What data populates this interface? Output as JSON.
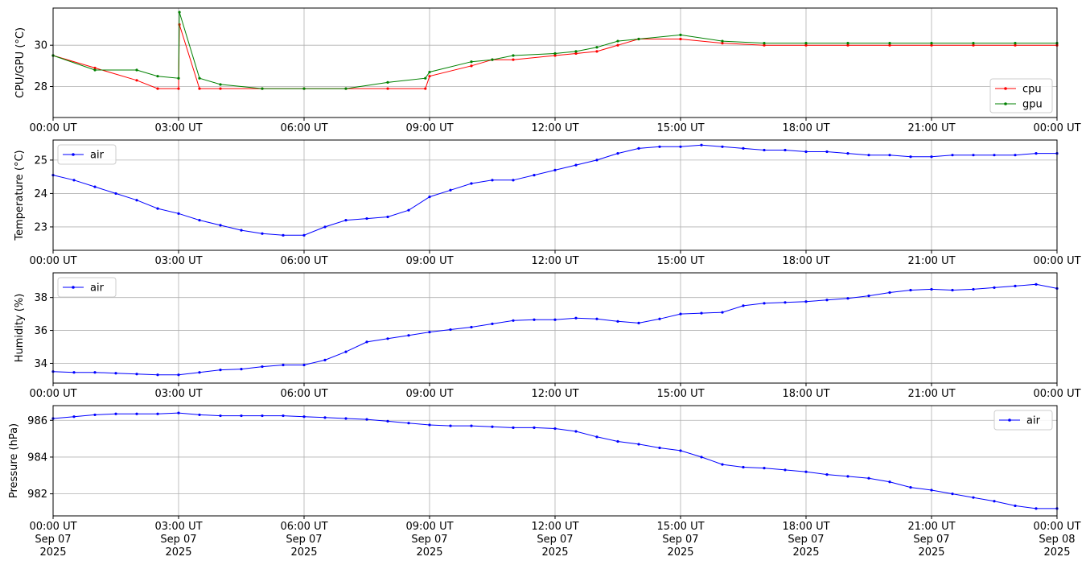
{
  "chart_data": [
    {
      "type": "line",
      "ylabel": "CPU/GPU (°C)",
      "ylim": [
        26.5,
        31.8
      ],
      "yticks": [
        28,
        30
      ],
      "xticks": [
        "00:00 UT",
        "03:00 UT",
        "06:00 UT",
        "09:00 UT",
        "12:00 UT",
        "15:00 UT",
        "18:00 UT",
        "21:00 UT",
        "00:00 UT"
      ],
      "xlim_hours": [
        0,
        24
      ],
      "grid": true,
      "legend": "lower-right",
      "series": [
        {
          "name": "cpu",
          "color": "#ff0000",
          "x": [
            0,
            1,
            2,
            2.5,
            3,
            3.02,
            3.5,
            4,
            5,
            6,
            7,
            8,
            8.9,
            9,
            10,
            10.5,
            11,
            12,
            12.5,
            13,
            13.5,
            14,
            15,
            16,
            17,
            18,
            19,
            20,
            21,
            22,
            23,
            24
          ],
          "y": [
            29.5,
            28.9,
            28.3,
            27.9,
            27.9,
            31.0,
            27.9,
            27.9,
            27.9,
            27.9,
            27.9,
            27.9,
            27.9,
            28.5,
            29.0,
            29.3,
            29.3,
            29.5,
            29.6,
            29.7,
            30.0,
            30.3,
            30.3,
            30.1,
            30.0,
            30.0,
            30.0,
            30.0,
            30.0,
            30.0,
            30.0,
            30.0
          ]
        },
        {
          "name": "gpu",
          "color": "#008000",
          "x": [
            0,
            1,
            2,
            2.5,
            3,
            3.02,
            3.5,
            4,
            5,
            6,
            7,
            8,
            8.9,
            9,
            10,
            10.5,
            11,
            12,
            12.5,
            13,
            13.5,
            14,
            15,
            16,
            17,
            18,
            19,
            20,
            21,
            22,
            23,
            24
          ],
          "y": [
            29.5,
            28.8,
            28.8,
            28.5,
            28.4,
            31.6,
            28.4,
            28.1,
            27.9,
            27.9,
            27.9,
            28.2,
            28.4,
            28.7,
            29.2,
            29.3,
            29.5,
            29.6,
            29.7,
            29.9,
            30.2,
            30.3,
            30.5,
            30.2,
            30.1,
            30.1,
            30.1,
            30.1,
            30.1,
            30.1,
            30.1,
            30.1
          ]
        }
      ]
    },
    {
      "type": "line",
      "ylabel": "Temperature (°C)",
      "ylim": [
        22.3,
        25.6
      ],
      "yticks": [
        23,
        24,
        25
      ],
      "xticks": [
        "00:00 UT",
        "03:00 UT",
        "06:00 UT",
        "09:00 UT",
        "12:00 UT",
        "15:00 UT",
        "18:00 UT",
        "21:00 UT",
        "00:00 UT"
      ],
      "xlim_hours": [
        0,
        24
      ],
      "grid": true,
      "legend": "upper-left",
      "series": [
        {
          "name": "air",
          "color": "#0000ff",
          "x": [
            0,
            0.5,
            1,
            1.5,
            2,
            2.5,
            3,
            3.5,
            4,
            4.5,
            5,
            5.5,
            6,
            6.5,
            7,
            7.5,
            8,
            8.5,
            9,
            9.5,
            10,
            10.5,
            11,
            11.5,
            12,
            12.5,
            13,
            13.5,
            14,
            14.5,
            15,
            15.5,
            16,
            16.5,
            17,
            17.5,
            18,
            18.5,
            19,
            19.5,
            20,
            20.5,
            21,
            21.5,
            22,
            22.5,
            23,
            23.5,
            24
          ],
          "y": [
            24.55,
            24.4,
            24.2,
            24.0,
            23.8,
            23.55,
            23.4,
            23.2,
            23.05,
            22.9,
            22.8,
            22.75,
            22.75,
            23.0,
            23.2,
            23.25,
            23.3,
            23.5,
            23.9,
            24.1,
            24.3,
            24.4,
            24.4,
            24.55,
            24.7,
            24.85,
            25.0,
            25.2,
            25.35,
            25.4,
            25.4,
            25.45,
            25.4,
            25.35,
            25.3,
            25.3,
            25.25,
            25.25,
            25.2,
            25.15,
            25.15,
            25.1,
            25.1,
            25.15,
            25.15,
            25.15,
            25.15,
            25.2,
            25.2
          ]
        }
      ]
    },
    {
      "type": "line",
      "ylabel": "Humidity (%)",
      "ylim": [
        32.8,
        39.5
      ],
      "yticks": [
        34,
        36,
        38
      ],
      "xticks": [
        "00:00 UT",
        "03:00 UT",
        "06:00 UT",
        "09:00 UT",
        "12:00 UT",
        "15:00 UT",
        "18:00 UT",
        "21:00 UT",
        "00:00 UT"
      ],
      "xlim_hours": [
        0,
        24
      ],
      "grid": true,
      "legend": "upper-left",
      "series": [
        {
          "name": "air",
          "color": "#0000ff",
          "x": [
            0,
            0.5,
            1,
            1.5,
            2,
            2.5,
            3,
            3.5,
            4,
            4.5,
            5,
            5.5,
            6,
            6.5,
            7,
            7.5,
            8,
            8.5,
            9,
            9.5,
            10,
            10.5,
            11,
            11.5,
            12,
            12.5,
            13,
            13.5,
            14,
            14.5,
            15,
            15.5,
            16,
            16.5,
            17,
            17.5,
            18,
            18.5,
            19,
            19.5,
            20,
            20.5,
            21,
            21.5,
            22,
            22.5,
            23,
            23.5,
            24
          ],
          "y": [
            33.5,
            33.45,
            33.45,
            33.4,
            33.35,
            33.3,
            33.3,
            33.45,
            33.6,
            33.65,
            33.8,
            33.9,
            33.9,
            34.2,
            34.7,
            35.3,
            35.5,
            35.7,
            35.9,
            36.05,
            36.2,
            36.4,
            36.6,
            36.65,
            36.65,
            36.75,
            36.7,
            36.55,
            36.45,
            36.7,
            37.0,
            37.05,
            37.1,
            37.5,
            37.65,
            37.7,
            37.75,
            37.85,
            37.95,
            38.1,
            38.3,
            38.45,
            38.5,
            38.45,
            38.5,
            38.6,
            38.7,
            38.8,
            38.55
          ]
        }
      ]
    },
    {
      "type": "line",
      "ylabel": "Pressure (hPa)",
      "ylim": [
        980.8,
        986.8
      ],
      "yticks": [
        982,
        984,
        986
      ],
      "xticks": [
        [
          "00:00 UT",
          "Sep 07",
          "2025"
        ],
        [
          "03:00 UT",
          "Sep 07",
          "2025"
        ],
        [
          "06:00 UT",
          "Sep 07",
          "2025"
        ],
        [
          "09:00 UT",
          "Sep 07",
          "2025"
        ],
        [
          "12:00 UT",
          "Sep 07",
          "2025"
        ],
        [
          "15:00 UT",
          "Sep 07",
          "2025"
        ],
        [
          "18:00 UT",
          "Sep 07",
          "2025"
        ],
        [
          "21:00 UT",
          "Sep 07",
          "2025"
        ],
        [
          "00:00 UT",
          "Sep 08",
          "2025"
        ]
      ],
      "xlim_hours": [
        0,
        24
      ],
      "grid": true,
      "legend": "upper-right",
      "series": [
        {
          "name": "air",
          "color": "#0000ff",
          "x": [
            0,
            0.5,
            1,
            1.5,
            2,
            2.5,
            3,
            3.5,
            4,
            4.5,
            5,
            5.5,
            6,
            6.5,
            7,
            7.5,
            8,
            8.5,
            9,
            9.5,
            10,
            10.5,
            11,
            11.5,
            12,
            12.5,
            13,
            13.5,
            14,
            14.5,
            15,
            15.5,
            16,
            16.5,
            17,
            17.5,
            18,
            18.5,
            19,
            19.5,
            20,
            20.5,
            21,
            21.5,
            22,
            22.5,
            23,
            23.5,
            24
          ],
          "y": [
            986.1,
            986.2,
            986.3,
            986.35,
            986.35,
            986.35,
            986.4,
            986.3,
            986.25,
            986.25,
            986.25,
            986.25,
            986.2,
            986.15,
            986.1,
            986.05,
            985.95,
            985.85,
            985.75,
            985.7,
            985.7,
            985.65,
            985.6,
            985.6,
            985.55,
            985.4,
            985.1,
            984.85,
            984.7,
            984.5,
            984.35,
            984.0,
            983.6,
            983.45,
            983.4,
            983.3,
            983.2,
            983.05,
            982.95,
            982.85,
            982.65,
            982.35,
            982.2,
            982.0,
            981.8,
            981.6,
            981.35,
            981.2,
            981.2
          ]
        }
      ]
    }
  ]
}
